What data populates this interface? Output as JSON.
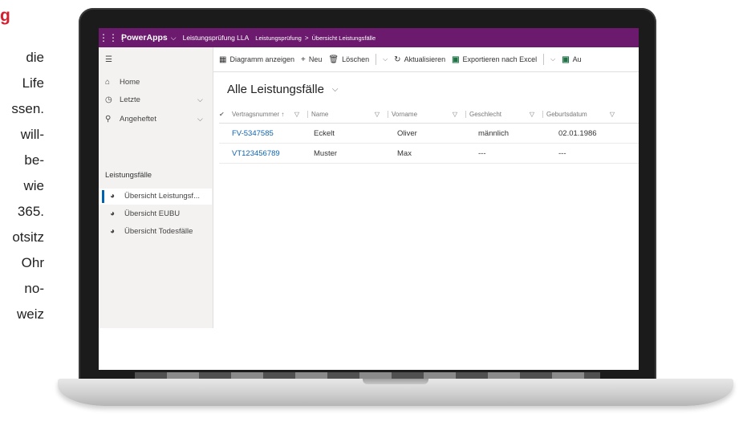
{
  "article": {
    "heading": "g",
    "lines": [
      "die",
      "Life",
      "ssen.",
      "will-",
      "be-",
      "wie",
      "365.",
      "otsitz",
      "Ohr",
      "no-",
      "weiz"
    ]
  },
  "topbar": {
    "app_name": "PowerApps",
    "crumb_app": "Leistungsprüfung LLA",
    "crumb_area": "Leistungsprüfung",
    "crumb_separator": ">",
    "crumb_page": "Übersicht Leistungsfälle"
  },
  "sidebar": {
    "items": [
      {
        "icon": "home-icon",
        "label": "Home"
      },
      {
        "icon": "clock-icon",
        "label": "Letzte"
      },
      {
        "icon": "pin-icon",
        "label": "Angeheftet"
      }
    ],
    "section_title": "Leistungsfälle",
    "nav": [
      {
        "label": "Übersicht Leistungsf..."
      },
      {
        "label": "Übersicht EUBU"
      },
      {
        "label": "Übersicht Todesfälle"
      }
    ]
  },
  "commands": {
    "chart": "Diagramm anzeigen",
    "new": "Neu",
    "delete": "Löschen",
    "refresh": "Aktualisieren",
    "export": "Exportieren nach Excel",
    "more": "Au"
  },
  "view": {
    "title": "Alle Leistungsfälle"
  },
  "grid": {
    "headers": [
      "Vertragsnummer",
      "Name",
      "Vorname",
      "Geschlecht",
      "Geburtsdatum"
    ],
    "sort_indicator": "↑",
    "rows": [
      {
        "vertragsnummer": "FV-5347585",
        "name": "Eckelt",
        "vorname": "Oliver",
        "geschlecht": "männlich",
        "geburtsdatum": "02.01.1986"
      },
      {
        "vertragsnummer": "VT123456789",
        "name": "Muster",
        "vorname": "Max",
        "geschlecht": "---",
        "geburtsdatum": "---"
      }
    ]
  },
  "colors": {
    "topbar": "#6b1a6e",
    "accent_link": "#0f63b0",
    "heading_red": "#d51f2f",
    "excel_green": "#1e7145"
  }
}
